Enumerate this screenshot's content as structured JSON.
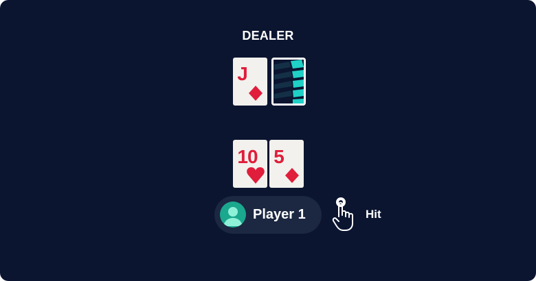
{
  "dealer": {
    "label": "DEALER",
    "cards": [
      {
        "rank": "J",
        "suit": "diamond"
      },
      {
        "face_down": true
      }
    ]
  },
  "player": {
    "name": "Player 1",
    "cards": [
      {
        "rank": "10",
        "suit": "heart"
      },
      {
        "rank": "5",
        "suit": "diamond"
      }
    ]
  },
  "action": {
    "label": "Hit",
    "icon": "tap-hand-icon"
  },
  "colors": {
    "table": "#0b1530",
    "card_face": "#f2f1ed",
    "suit_red": "#e01d3b",
    "card_back_stripes": "#1fd1c7",
    "avatar": "#1aa88e",
    "player_pill": "#1c2741"
  }
}
